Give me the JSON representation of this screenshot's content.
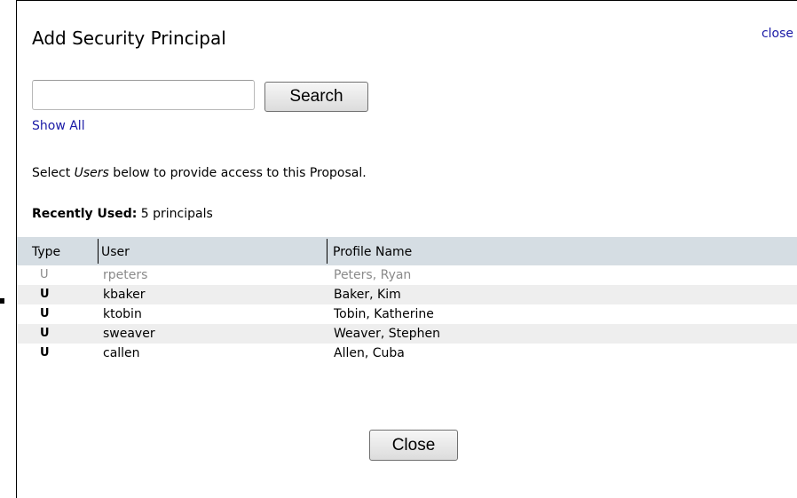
{
  "dialog": {
    "title": "Add Security Principal",
    "close_link": "close"
  },
  "search": {
    "input_value": "",
    "button_label": "Search",
    "show_all_label": "Show All"
  },
  "instruction": {
    "prefix": "Select ",
    "emphasis": "Users",
    "suffix": " below to provide access to this Proposal."
  },
  "recently_used": {
    "label": "Recently Used:",
    "count_text": "5 principals"
  },
  "table": {
    "headers": {
      "type": "Type",
      "user": "User",
      "profile": "Profile Name"
    },
    "rows": [
      {
        "type": "U",
        "user": "rpeters",
        "profile": "Peters, Ryan"
      },
      {
        "type": "U",
        "user": "kbaker",
        "profile": "Baker, Kim"
      },
      {
        "type": "U",
        "user": "ktobin",
        "profile": "Tobin, Katherine"
      },
      {
        "type": "U",
        "user": "sweaver",
        "profile": "Weaver, Stephen"
      },
      {
        "type": "U",
        "user": "callen",
        "profile": "Allen, Cuba"
      }
    ]
  },
  "footer": {
    "close_button": "Close"
  },
  "colors": {
    "link": "#1a1aa6",
    "header_bg": "#d5dde3",
    "alt_row_bg": "#eeeeee",
    "dim_text": "#8a8a8a"
  }
}
